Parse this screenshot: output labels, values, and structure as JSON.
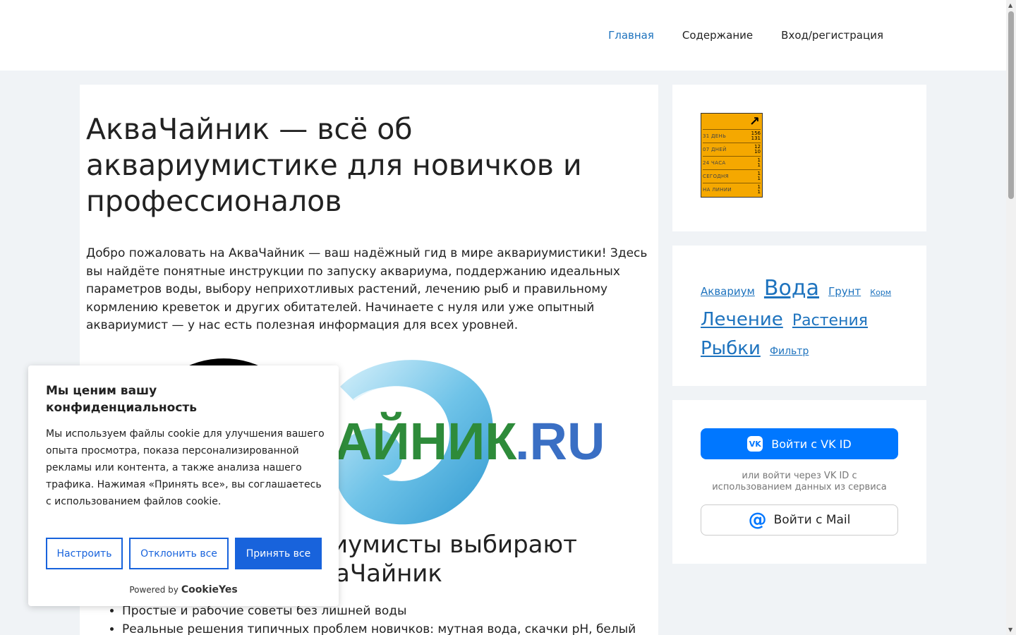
{
  "nav": {
    "items": [
      "Главная",
      "Содержание",
      "Вход/регистрация"
    ]
  },
  "main": {
    "title": "АкваЧайник — всё об аквариумистике для новичков и профессионалов",
    "intro": "Добро пожаловать на АкваЧайник — ваш надёжный гид в мире аквариумистики! Здесь вы найдёте понятные инструкции по запуску аквариума, поддержанию идеальных параметров воды, выбору неприхотливых растений, лечению рыб и правильному кормлению креветок и других обитателей. Начинаете с нуля или уже опытный аквариумист — у нас есть полезная информация для всех уровней.",
    "logo_text": "АЙНИК",
    "logo_suffix": ".RU",
    "subtitle_line1": "иумисты выбирают",
    "subtitle_line2": "аЧайник",
    "features": [
      "Простые и рабочие советы без лишней воды",
      "Реальные решения типичных проблем новичков: мутная вода, скачки pH, белый"
    ]
  },
  "counter": {
    "rows": [
      {
        "label": "31 ДЕНЬ",
        "v1": "156",
        "v2": "131"
      },
      {
        "label": "07 ДНЕЙ",
        "v1": "12",
        "v2": "10"
      },
      {
        "label": "24 ЧАСА",
        "v1": "1",
        "v2": "1"
      },
      {
        "label": "СЕГОДНЯ",
        "v1": "1",
        "v2": "1"
      },
      {
        "label": "НА ЛИНИИ",
        "v1": "1",
        "v2": "1"
      }
    ]
  },
  "tags": [
    {
      "label": "Аквариум",
      "size": 15
    },
    {
      "label": "Вода",
      "size": 30
    },
    {
      "label": "Грунт",
      "size": 15
    },
    {
      "label": "Корм",
      "size": 11
    },
    {
      "label": "Лечение",
      "size": 26
    },
    {
      "label": "Растения",
      "size": 22
    },
    {
      "label": "Рыбки",
      "size": 26
    },
    {
      "label": "Фильтр",
      "size": 14
    }
  ],
  "auth": {
    "vk_button": "Войти с VK ID",
    "vk_icon": "VK",
    "vk_note": "или войти через VK ID с использованием данных из сервиса",
    "mail_button": "Войти с Mail",
    "mail_icon": "@"
  },
  "cookie": {
    "title": "Мы ценим вашу конфиденциальность",
    "text": "Мы используем файлы cookie для улучшения вашего опыта просмотра, показа персонализированной рекламы или контента, а также анализа нашего трафика. Нажимая «Принять все», вы соглашаетесь с использованием файлов cookie.",
    "customize": "Настроить",
    "reject": "Отклонить все",
    "accept": "Принять все",
    "powered": "Powered by",
    "brand": "CookieYes"
  },
  "colors": {
    "accent": "#1e73be",
    "cookie_blue": "#1863dc",
    "vk_blue": "#0077ff",
    "counter_orange": "#f5a800",
    "logo_green": "#2e8b3a",
    "logo_blue": "#3a6fc4"
  }
}
